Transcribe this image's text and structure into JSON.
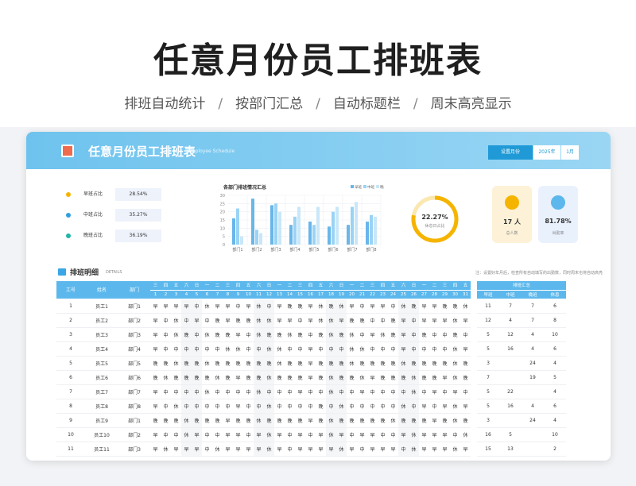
{
  "hero": {
    "title": "任意月份员工排班表",
    "features": [
      "排班自动统计",
      "按部门汇总",
      "自动标题栏",
      "周末高亮显示"
    ],
    "separator": "/"
  },
  "app": {
    "title": "任意月份员工排班表",
    "subtitle": "Employee Schedule",
    "month_label": "设置月份",
    "year_value": "2025年",
    "month_value": "1月",
    "colors": {
      "banner": "#7cc9f0",
      "accent": "#1f9ad6",
      "morning": "#f5b400",
      "middle": "#2f9fe0",
      "night": "#22b5a5"
    }
  },
  "summary": {
    "stats": [
      {
        "label": "早班占比",
        "value": "28.54%",
        "color": "#f5b400"
      },
      {
        "label": "中班占比",
        "value": "35.27%",
        "color": "#2f9fe0"
      },
      {
        "label": "晚班占比",
        "value": "36.19%",
        "color": "#22b5a5"
      }
    ],
    "ring": {
      "value": "22.27%",
      "label": "休息日占比",
      "fraction": 0.7773
    },
    "kpis": [
      {
        "value": "17 人",
        "label": "总人数",
        "icon": "people-icon"
      },
      {
        "value": "81.78%",
        "label": "出勤率",
        "icon": "attendance-icon"
      }
    ]
  },
  "chart_data": {
    "type": "bar",
    "title": "各部门排班情况汇总",
    "categories": [
      "部门1",
      "部门2",
      "部门3",
      "部门4",
      "部门5",
      "部门6",
      "部门7",
      "部门8"
    ],
    "series": [
      {
        "name": "早班",
        "values": [
          16,
          28,
          24,
          12,
          14,
          11,
          12,
          14
        ],
        "color": "#68b6ea"
      },
      {
        "name": "中班",
        "values": [
          22,
          9,
          25,
          17,
          12,
          20,
          23,
          18
        ],
        "color": "#9ad3f4"
      },
      {
        "name": "晚班",
        "values": [
          5,
          7,
          20,
          23,
          23,
          23,
          26,
          17
        ],
        "color": "#c9e7f8"
      }
    ],
    "ylim": [
      0,
      30
    ],
    "yticks": [
      "30",
      "25",
      "20",
      "15",
      "10",
      "5",
      "0"
    ],
    "legend": "top-right",
    "grid": true
  },
  "detail": {
    "title": "排班明细",
    "subtitle": "DETAILS",
    "note": "注：设置好年月后，检查所有自动填写的出勤数，同时周末也将自动高亮",
    "headers": {
      "id": "工号",
      "name": "姓名",
      "dept": "部门",
      "summary": "排班汇总"
    },
    "weekday_row": [
      "三",
      "四",
      "五",
      "六",
      "日",
      "一",
      "二",
      "三",
      "四",
      "五",
      "六",
      "日",
      "一",
      "二",
      "三",
      "四",
      "五",
      "六",
      "日",
      "一",
      "二",
      "三",
      "四",
      "五",
      "六",
      "日",
      "一",
      "二",
      "三",
      "四",
      "五"
    ],
    "date_row": [
      "1",
      "2",
      "3",
      "4",
      "5",
      "6",
      "7",
      "8",
      "9",
      "10",
      "11",
      "12",
      "13",
      "14",
      "15",
      "16",
      "17",
      "18",
      "19",
      "20",
      "21",
      "22",
      "23",
      "24",
      "25",
      "26",
      "27",
      "28",
      "29",
      "30",
      "31"
    ],
    "summary_headers": [
      "早班",
      "中班",
      "晚班",
      "休息"
    ],
    "rows": [
      {
        "id": "1",
        "name": "员工1",
        "dept": "部门1",
        "shifts": [
          "早",
          "早",
          "早",
          "早",
          "中",
          "休",
          "早",
          "早",
          "中",
          "早",
          "休",
          "中",
          "早",
          "晚",
          "晚",
          "早",
          "休",
          "晚",
          "休",
          "早",
          "中",
          "早",
          "早",
          "中",
          "休",
          "晚",
          "早",
          "早",
          "晚",
          "晚",
          "休"
        ],
        "sum": [
          "11",
          "7",
          "7",
          "6"
        ]
      },
      {
        "id": "2",
        "name": "员工2",
        "dept": "部门2",
        "shifts": [
          "早",
          "中",
          "休",
          "中",
          "早",
          "中",
          "晚",
          "早",
          "晚",
          "晚",
          "休",
          "休",
          "早",
          "早",
          "中",
          "早",
          "休",
          "休",
          "早",
          "晚",
          "晚",
          "中",
          "中",
          "晚",
          "早",
          "中",
          "早",
          "早",
          "早",
          "休",
          "早"
        ],
        "sum": [
          "12",
          "4",
          "7",
          "8"
        ]
      },
      {
        "id": "3",
        "name": "员工3",
        "dept": "部门3",
        "shifts": [
          "早",
          "中",
          "休",
          "晚",
          "中",
          "休",
          "晚",
          "晚",
          "早",
          "中",
          "休",
          "晚",
          "晚",
          "休",
          "晚",
          "中",
          "晚",
          "休",
          "晚",
          "休",
          "中",
          "早",
          "休",
          "晚",
          "早",
          "中",
          "晚",
          "中",
          "中",
          "晚",
          "中"
        ],
        "sum": [
          "5",
          "12",
          "4",
          "10"
        ]
      },
      {
        "id": "4",
        "name": "员工4",
        "dept": "部门4",
        "shifts": [
          "早",
          "中",
          "中",
          "中",
          "中",
          "中",
          "中",
          "休",
          "休",
          "中",
          "中",
          "休",
          "休",
          "中",
          "中",
          "早",
          "中",
          "中",
          "中",
          "休",
          "休",
          "中",
          "中",
          "中",
          "早",
          "中",
          "中",
          "中",
          "中",
          "休",
          "早"
        ],
        "sum": [
          "5",
          "16",
          "4",
          "6"
        ]
      },
      {
        "id": "5",
        "name": "员工5",
        "dept": "部门5",
        "shifts": [
          "晚",
          "晚",
          "休",
          "晚",
          "晚",
          "休",
          "晚",
          "晚",
          "晚",
          "晚",
          "晚",
          "晚",
          "休",
          "晚",
          "晚",
          "早",
          "晚",
          "晚",
          "晚",
          "休",
          "晚",
          "晚",
          "晚",
          "晚",
          "休",
          "晚",
          "晚",
          "晚",
          "晚",
          "休",
          "晚"
        ],
        "sum": [
          "3",
          "",
          "24",
          "4"
        ]
      },
      {
        "id": "6",
        "name": "员工6",
        "dept": "部门6",
        "shifts": [
          "晚",
          "休",
          "晚",
          "晚",
          "晚",
          "晚",
          "休",
          "晚",
          "早",
          "晚",
          "晚",
          "休",
          "晚",
          "晚",
          "晚",
          "早",
          "晚",
          "休",
          "晚",
          "晚",
          "休",
          "早",
          "晚",
          "晚",
          "晚",
          "休",
          "晚",
          "晚",
          "早",
          "休",
          "晚"
        ],
        "sum": [
          "7",
          "",
          "19",
          "5"
        ]
      },
      {
        "id": "7",
        "name": "员工7",
        "dept": "部门7",
        "shifts": [
          "早",
          "中",
          "中",
          "中",
          "中",
          "休",
          "中",
          "中",
          "中",
          "中",
          "休",
          "中",
          "中",
          "中",
          "早",
          "中",
          "中",
          "休",
          "中",
          "中",
          "早",
          "中",
          "中",
          "中",
          "中",
          "休",
          "中",
          "早",
          "中",
          "早",
          "中"
        ],
        "sum": [
          "5",
          "22",
          "",
          "4"
        ]
      },
      {
        "id": "8",
        "name": "员工8",
        "dept": "部门8",
        "shifts": [
          "早",
          "中",
          "休",
          "中",
          "中",
          "中",
          "中",
          "中",
          "早",
          "中",
          "中",
          "休",
          "中",
          "中",
          "中",
          "中",
          "晚",
          "中",
          "休",
          "中",
          "中",
          "中",
          "中",
          "中",
          "休",
          "中",
          "早",
          "中",
          "早",
          "休",
          "早"
        ],
        "sum": [
          "5",
          "16",
          "4",
          "6"
        ]
      },
      {
        "id": "9",
        "name": "员工9",
        "dept": "部门1",
        "shifts": [
          "晚",
          "晚",
          "晚",
          "休",
          "晚",
          "晚",
          "晚",
          "早",
          "晚",
          "晚",
          "休",
          "晚",
          "晚",
          "晚",
          "晚",
          "早",
          "晚",
          "休",
          "晚",
          "晚",
          "晚",
          "晚",
          "晚",
          "休",
          "晚",
          "晚",
          "晚",
          "早",
          "晚",
          "休",
          "晚"
        ],
        "sum": [
          "3",
          "",
          "24",
          "4"
        ]
      },
      {
        "id": "10",
        "name": "员工10",
        "dept": "部门2",
        "shifts": [
          "早",
          "中",
          "中",
          "休",
          "早",
          "中",
          "中",
          "早",
          "早",
          "中",
          "早",
          "休",
          "早",
          "中",
          "早",
          "中",
          "早",
          "休",
          "早",
          "中",
          "早",
          "早",
          "中",
          "中",
          "早",
          "休",
          "早",
          "早",
          "早",
          "中",
          "休"
        ],
        "sum": [
          "16",
          "5",
          "",
          "10"
        ]
      },
      {
        "id": "11",
        "name": "员工11",
        "dept": "部门3",
        "shifts": [
          "早",
          "休",
          "早",
          "早",
          "早",
          "中",
          "休",
          "早",
          "早",
          "早",
          "早",
          "休",
          "早",
          "中",
          "早",
          "早",
          "早",
          "早",
          "休",
          "早",
          "中",
          "早",
          "早",
          "早",
          "中",
          "休",
          "早",
          "早",
          "早",
          "休",
          "早"
        ],
        "sum": [
          "15",
          "13",
          "",
          "2"
        ]
      }
    ]
  }
}
